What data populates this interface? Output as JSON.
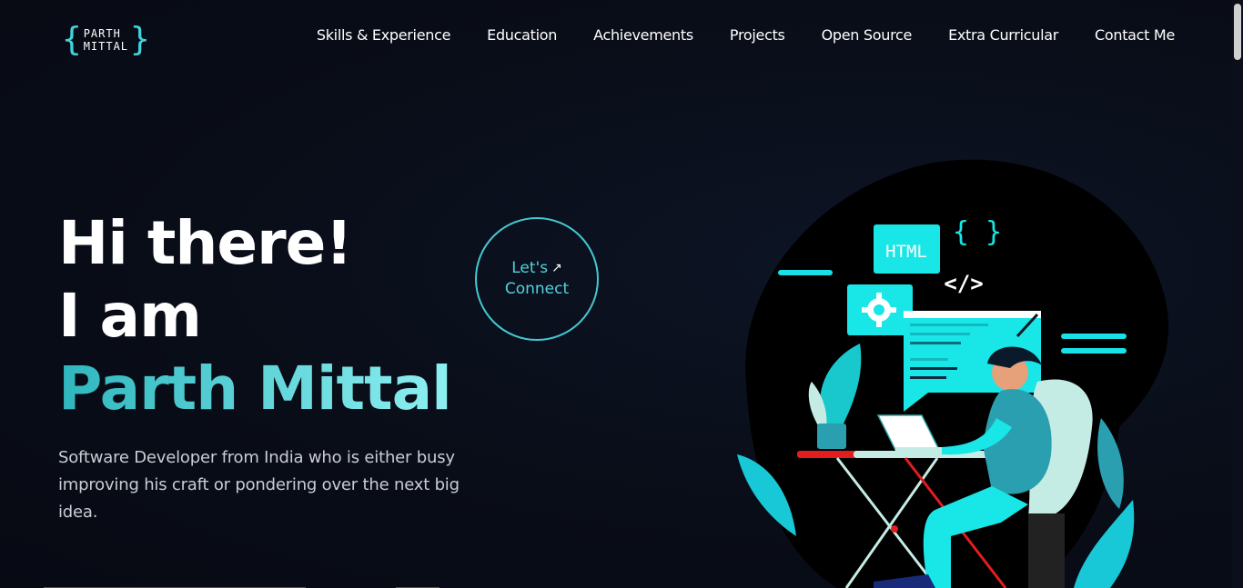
{
  "logo": {
    "line1": "PARTH",
    "line2": "MITTAL"
  },
  "nav": {
    "items": [
      {
        "label": "Skills & Experience"
      },
      {
        "label": "Education"
      },
      {
        "label": "Achievements"
      },
      {
        "label": "Projects"
      },
      {
        "label": "Open Source"
      },
      {
        "label": "Extra Curricular"
      },
      {
        "label": "Contact Me"
      }
    ]
  },
  "hero": {
    "line1": "Hi there!",
    "line2": "I am",
    "name": "Parth Mittal",
    "subtitle": "Software Developer from India who is either busy improving his craft or pondering over the next big idea."
  },
  "connect": {
    "line1": "Let's",
    "line2": "Connect",
    "arrow": "↗"
  },
  "illustration": {
    "html_label": "HTML",
    "braces": "{ }",
    "code_tag": "</>"
  },
  "colors": {
    "accent": "#3fd4dc",
    "background": "#090d18",
    "cyan": "#19e6e6",
    "red": "#e01e1e"
  }
}
